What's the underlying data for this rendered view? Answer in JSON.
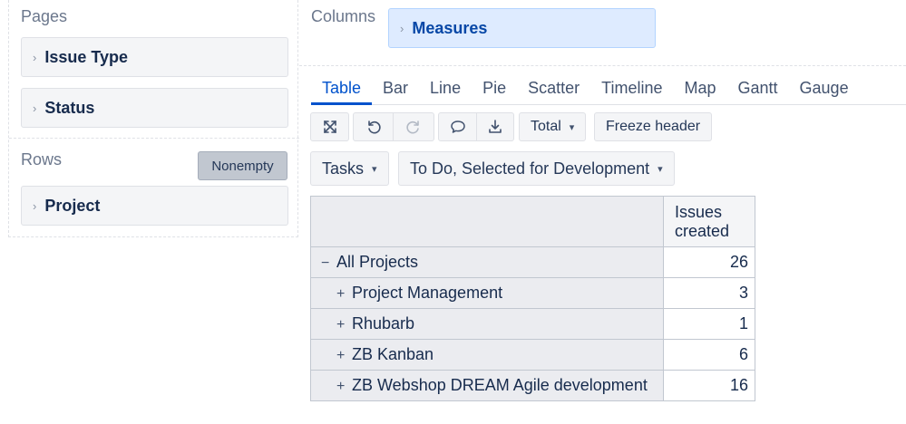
{
  "pages": {
    "label": "Pages",
    "items": [
      {
        "label": "Issue Type"
      },
      {
        "label": "Status"
      }
    ]
  },
  "rows": {
    "label": "Rows",
    "nonempty_label": "Nonempty",
    "items": [
      {
        "label": "Project"
      }
    ]
  },
  "columns": {
    "label": "Columns",
    "items": [
      {
        "label": "Measures"
      }
    ]
  },
  "tabs": [
    {
      "label": "Table",
      "active": true
    },
    {
      "label": "Bar"
    },
    {
      "label": "Line"
    },
    {
      "label": "Pie"
    },
    {
      "label": "Scatter"
    },
    {
      "label": "Timeline"
    },
    {
      "label": "Map"
    },
    {
      "label": "Gantt"
    },
    {
      "label": "Gauge"
    }
  ],
  "toolbar": {
    "icons": [
      "fullscreen-icon",
      "undo-icon",
      "redo-icon",
      "comment-icon",
      "export-icon"
    ],
    "total_label": "Total",
    "freeze_label": "Freeze header"
  },
  "filters": {
    "measure_filter": "Tasks",
    "status_filter": "To Do, Selected for Development"
  },
  "table": {
    "column_header": "Issues created",
    "column_header_lines": [
      "Issues",
      "created"
    ],
    "rows": [
      {
        "label": "All Projects",
        "value": "26",
        "expander": "−",
        "level": 0
      },
      {
        "label": "Project Management",
        "value": "3",
        "expander": "+",
        "level": 1
      },
      {
        "label": "Rhubarb",
        "value": "1",
        "expander": "+",
        "level": 1
      },
      {
        "label": "ZB Kanban",
        "value": "6",
        "expander": "+",
        "level": 1
      },
      {
        "label": "ZB Webshop DREAM Agile development",
        "value": "16",
        "expander": "+",
        "level": 1
      }
    ]
  },
  "colors": {
    "accent": "#0052cc",
    "measures_bg": "#deebff",
    "pill_bg": "#f4f5f7"
  }
}
